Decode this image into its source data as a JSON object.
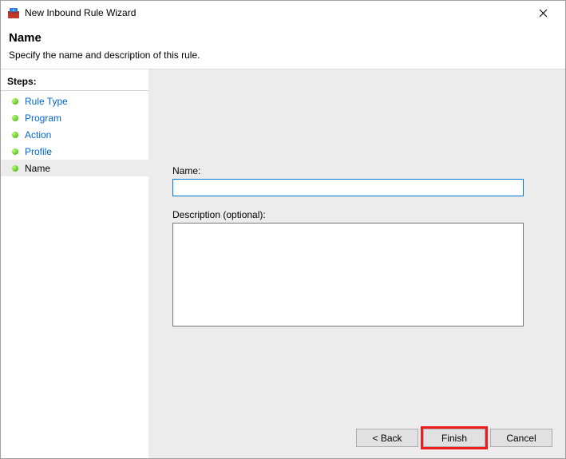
{
  "titlebar": {
    "title": "New Inbound Rule Wizard"
  },
  "header": {
    "page_title": "Name",
    "subtitle": "Specify the name and description of this rule."
  },
  "sidebar": {
    "steps_label": "Steps:",
    "items": [
      {
        "label": "Rule Type"
      },
      {
        "label": "Program"
      },
      {
        "label": "Action"
      },
      {
        "label": "Profile"
      },
      {
        "label": "Name"
      }
    ]
  },
  "form": {
    "name_label": "Name:",
    "name_value": "",
    "desc_label": "Description (optional):",
    "desc_value": ""
  },
  "buttons": {
    "back": "< Back",
    "finish": "Finish",
    "cancel": "Cancel"
  }
}
